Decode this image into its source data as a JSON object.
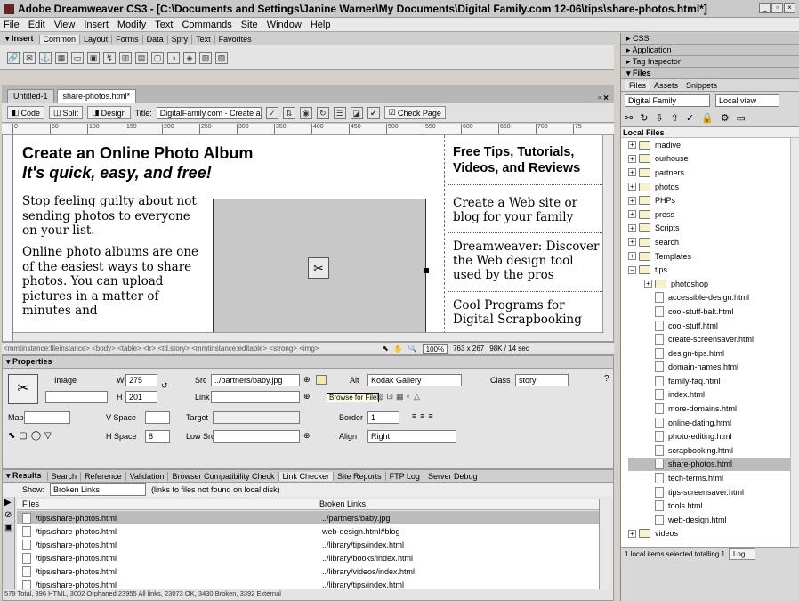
{
  "app": {
    "title": "Adobe Dreamweaver CS3 - [C:\\Documents and Settings\\Janine Warner\\My Documents\\Digital Family.com 12-06\\tips\\share-photos.html*]"
  },
  "menu": [
    "File",
    "Edit",
    "View",
    "Insert",
    "Modify",
    "Text",
    "Commands",
    "Site",
    "Window",
    "Help"
  ],
  "insert_bar": {
    "label": "▾ Insert",
    "tabs": [
      "Common",
      "Layout",
      "Forms",
      "Data",
      "Spry",
      "Text",
      "Favorites"
    ]
  },
  "doc_tabs": [
    "Untitled-1",
    "share-photos.html*"
  ],
  "doc_toolbar": {
    "code": "Code",
    "split": "Split",
    "design": "Design",
    "title_label": "Title:",
    "title_value": "DigitalFamily.com - Create an",
    "check_page": "Check Page"
  },
  "ruler_ticks": [
    "0",
    "50",
    "100",
    "150",
    "200",
    "250",
    "300",
    "350",
    "400",
    "450",
    "500",
    "550",
    "600",
    "650",
    "700",
    "75"
  ],
  "page": {
    "heading": "Create an Online Photo Album",
    "subheading": "It's quick, easy, and free!",
    "para1": "Stop feeling guilty about not sending photos to everyone on your list.",
    "para2": "Online photo albums are one of the easiest ways to share photos. You can upload pictures in a matter of minutes and",
    "right_heading": "Free Tips, Tutorials, Videos, and Reviews",
    "right_items": [
      "Create a Web site or blog for your family",
      "Dreamweaver: Discover the Web design tool used by the pros",
      "Cool Programs for Digital Scrapbooking"
    ]
  },
  "status_bar": {
    "tags": "<mmtinstance:fileinstance> <body> <table> <tr> <td.story> <mmtinstance:editable> <strong> <img>",
    "zoom": "100%",
    "size": "763 x 267",
    "weight": "98K / 14 sec"
  },
  "properties": {
    "title": "▾ Properties",
    "image_label": "Image",
    "w_label": "W",
    "w_value": "275",
    "h_label": "H",
    "h_value": "201",
    "src_label": "Src",
    "src_value": "../partners/baby.jpg",
    "alt_label": "Alt",
    "alt_value": "Kodak Gallery",
    "class_label": "Class",
    "class_value": "story",
    "link_label": "Link",
    "tooltip": "Browse for File",
    "edit_label": "Edit",
    "map_label": "Map",
    "vspace_label": "V Space",
    "target_label": "Target",
    "border_label": "Border",
    "border_value": "1",
    "hspace_label": "H Space",
    "hspace_value": "8",
    "lowsrc_label": "Low Src",
    "align_label": "Align",
    "align_value": "Right"
  },
  "results": {
    "title": "▾ Results",
    "tabs": [
      "Search",
      "Reference",
      "Validation",
      "Browser Compatibility Check",
      "Link Checker",
      "Site Reports",
      "FTP Log",
      "Server Debug"
    ],
    "show_label": "Show:",
    "show_value": "Broken Links",
    "show_note": "(links to files not found on local disk)",
    "col_files": "Files",
    "col_broken": "Broken Links",
    "rows": [
      {
        "file": "/tips/share-photos.html",
        "link": "../partners/baby.jpg"
      },
      {
        "file": "/tips/share-photos.html",
        "link": "web-design.html#blog"
      },
      {
        "file": "/tips/share-photos.html",
        "link": "../library/tips/index.html"
      },
      {
        "file": "/tips/share-photos.html",
        "link": "../library/books/index.html"
      },
      {
        "file": "/tips/share-photos.html",
        "link": "../library/videos/index.html"
      },
      {
        "file": "/tips/share-photos.html",
        "link": "../library/tips/index.html"
      }
    ],
    "summary": "579 Total, 396 HTML, 3002 Orphaned 23955 All links, 23073 OK, 3430 Broken, 3392 External"
  },
  "side": {
    "css": "▸ CSS",
    "application": "▸ Application",
    "tag_inspector": "▸ Tag Inspector",
    "files": "▾ Files",
    "tabs": [
      "Files",
      "Assets",
      "Snippets"
    ],
    "site": "Digital Family",
    "view": "Local view",
    "local_files": "Local Files",
    "folders": [
      "madive",
      "ourhouse",
      "partners",
      "photos",
      "PHPs",
      "press",
      "Scripts",
      "search",
      "Templates",
      "tips"
    ],
    "subfolder": "photoshop",
    "files_list": [
      "accessible-design.html",
      "cool-stuff-bak.html",
      "cool-stuff.html",
      "create-screensaver.html",
      "design-tips.html",
      "domain-names.html",
      "family-faq.html",
      "index.html",
      "more-domains.html",
      "online-dating.html",
      "photo-editing.html",
      "scrapbooking.html",
      "share-photos.html",
      "tech-terms.html",
      "tips-screensaver.html",
      "tools.html",
      "web-design.html"
    ],
    "last_folder": "videos",
    "selected_file": "share-photos.html",
    "status": "1 local items selected totalling 1",
    "log": "Log..."
  }
}
